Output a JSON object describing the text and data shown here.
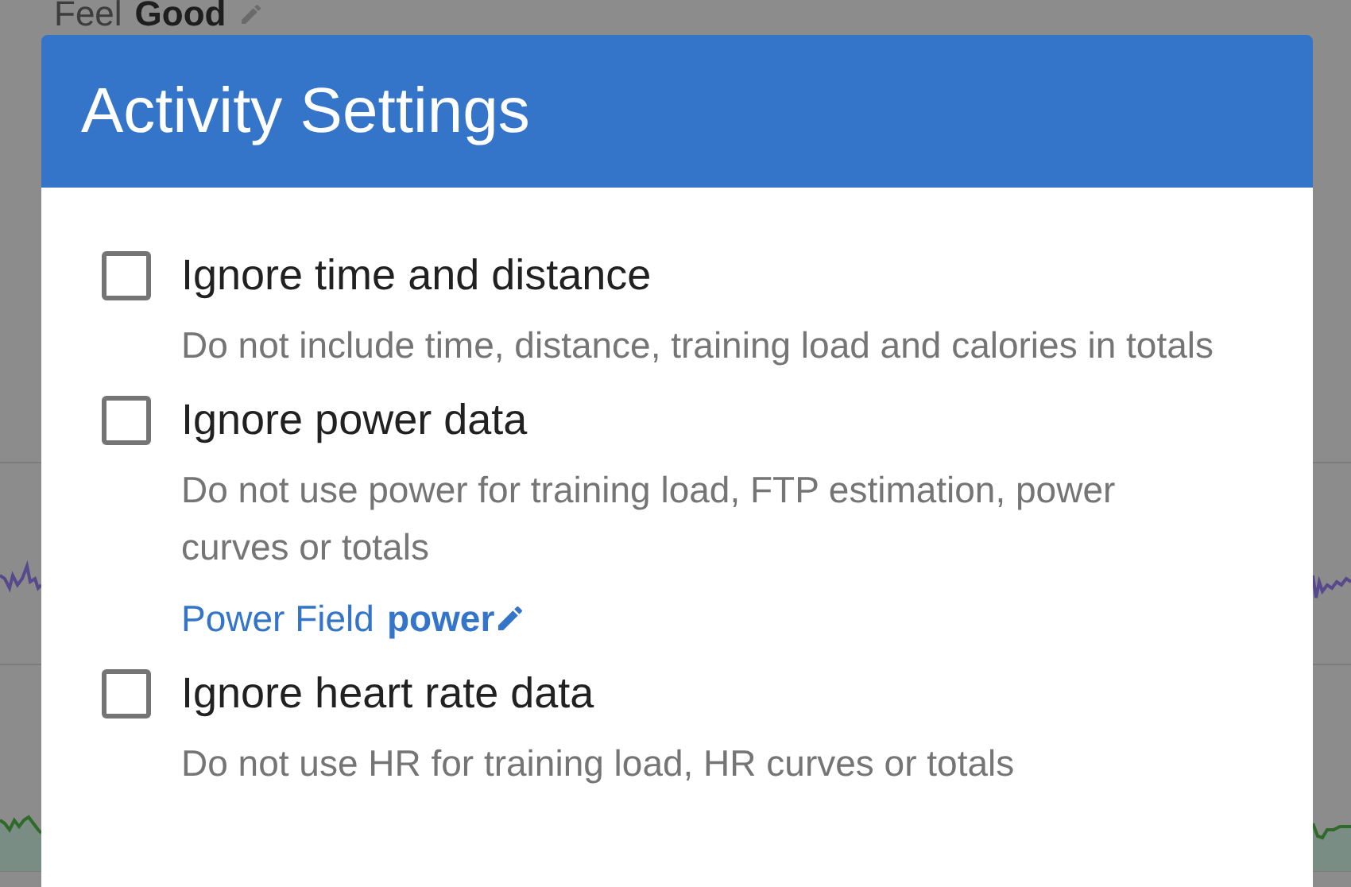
{
  "background": {
    "feel": {
      "label": "Feel",
      "value": "Good"
    }
  },
  "dialog": {
    "title": "Activity Settings",
    "options": [
      {
        "label": "Ignore time and distance",
        "checked": false,
        "description": "Do not include time, distance, training load and calories in totals"
      },
      {
        "label": "Ignore power data",
        "checked": false,
        "description": "Do not use power for training load, FTP estimation, power curves or totals",
        "field": {
          "label": "Power Field",
          "value": "power"
        }
      },
      {
        "label": "Ignore heart rate data",
        "checked": false,
        "description": "Do not use HR for training load, HR curves or totals"
      }
    ]
  }
}
